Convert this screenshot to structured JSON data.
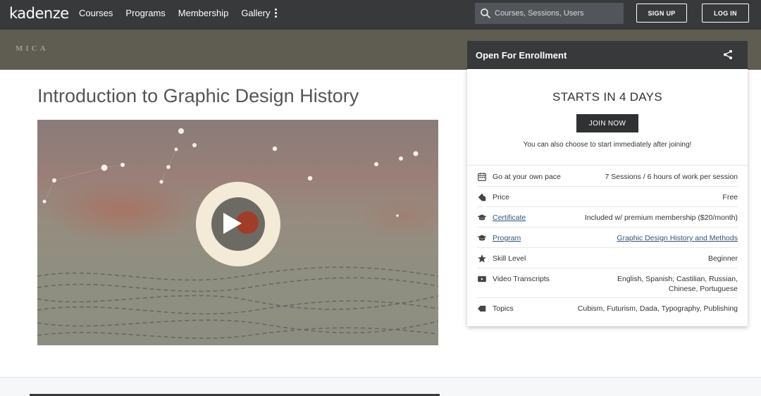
{
  "nav": {
    "logo": "kadenze",
    "links": [
      "Courses",
      "Programs",
      "Membership",
      "Gallery"
    ],
    "search_placeholder": "Courses, Sessions, Users",
    "signup_label": "SIGN UP",
    "login_label": "LOG IN"
  },
  "banner": {
    "institution": "MICA"
  },
  "course": {
    "title": "Introduction to Graphic Design History"
  },
  "enrollment": {
    "header": "Open For Enrollment",
    "starts_text": "STARTS IN 4 DAYS",
    "join_label": "JOIN NOW",
    "note": "You can also choose to start immediately after joining!",
    "details": [
      {
        "icon": "calendar-icon",
        "label": "Go at your own pace",
        "value": "7 Sessions / 6 hours of work per session",
        "label_link": false,
        "value_link": false
      },
      {
        "icon": "tag-icon",
        "label": "Price",
        "value": "Free",
        "label_link": false,
        "value_link": false
      },
      {
        "icon": "mortarboard-icon",
        "label": "Certificate",
        "value": "Included w/ premium membership ($20/month)",
        "label_link": true,
        "value_link": false
      },
      {
        "icon": "mortarboard-icon",
        "label": "Program",
        "value": "Graphic Design History and Methods",
        "label_link": true,
        "value_link": true
      },
      {
        "icon": "star-icon",
        "label": "Skill Level",
        "value": "Beginner",
        "label_link": false,
        "value_link": false
      },
      {
        "icon": "video-icon",
        "label": "Video Transcripts",
        "value": "English, Spanish; Castilian, Russian, Chinese, Portuguese",
        "label_link": false,
        "value_link": false
      },
      {
        "icon": "label-icon",
        "label": "Topics",
        "value": "Cubism, Futurism, Dada, Typography, Publishing",
        "label_link": false,
        "value_link": false
      }
    ]
  },
  "colors": {
    "nav_bg": "#37393b",
    "banner_bg": "#5f5c52",
    "link": "#2f5677",
    "play_accent": "#a8351f"
  }
}
